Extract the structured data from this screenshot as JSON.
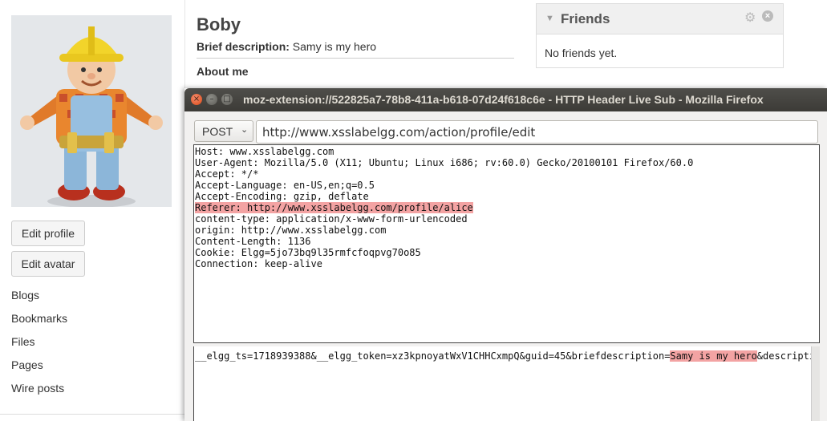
{
  "profile": {
    "name": "Boby",
    "brief_label": "Brief description:",
    "brief_value": "Samy is my hero",
    "about_label": "About me",
    "buttons": {
      "edit_profile": "Edit profile",
      "edit_avatar": "Edit avatar"
    },
    "links": [
      "Blogs",
      "Bookmarks",
      "Files",
      "Pages",
      "Wire posts"
    ]
  },
  "friends_widget": {
    "title": "Friends",
    "empty_text": "No friends yet.",
    "icons": [
      "caret-down-icon",
      "gear-icon",
      "close-icon"
    ]
  },
  "ff_window": {
    "title": "moz-extension://522825a7-78b8-411a-b618-07d24f618c6e - HTTP Header Live Sub - Mozilla Firefox",
    "controls": [
      "close-icon",
      "minimize-icon",
      "maximize-icon"
    ],
    "method": "POST",
    "url": "http://www.xsslabelgg.com/action/profile/edit",
    "headers": [
      "Host: www.xsslabelgg.com",
      "User-Agent: Mozilla/5.0 (X11; Ubuntu; Linux i686; rv:60.0) Gecko/20100101 Firefox/60.0",
      "Accept: */*",
      "Accept-Language: en-US,en;q=0.5",
      "Accept-Encoding: gzip, deflate",
      "Referer: http://www.xsslabelgg.com/profile/alice",
      "content-type: application/x-www-form-urlencoded",
      "origin: http://www.xsslabelgg.com",
      "Content-Length: 1136",
      "Cookie: Elgg=5jo73bq9l35rmfcfoqpvg70o85",
      "Connection: keep-alive"
    ],
    "body_before": "__elgg_ts=1718939388&__elgg_token=xz3kpnoyatWxV1CHHCxmpQ&guid=45&briefdescription=",
    "body_highlight": "Samy is my hero",
    "body_after": "&description="
  },
  "colors": {
    "highlight": "#f3a3a3",
    "titlebar": "#3c3b37"
  }
}
